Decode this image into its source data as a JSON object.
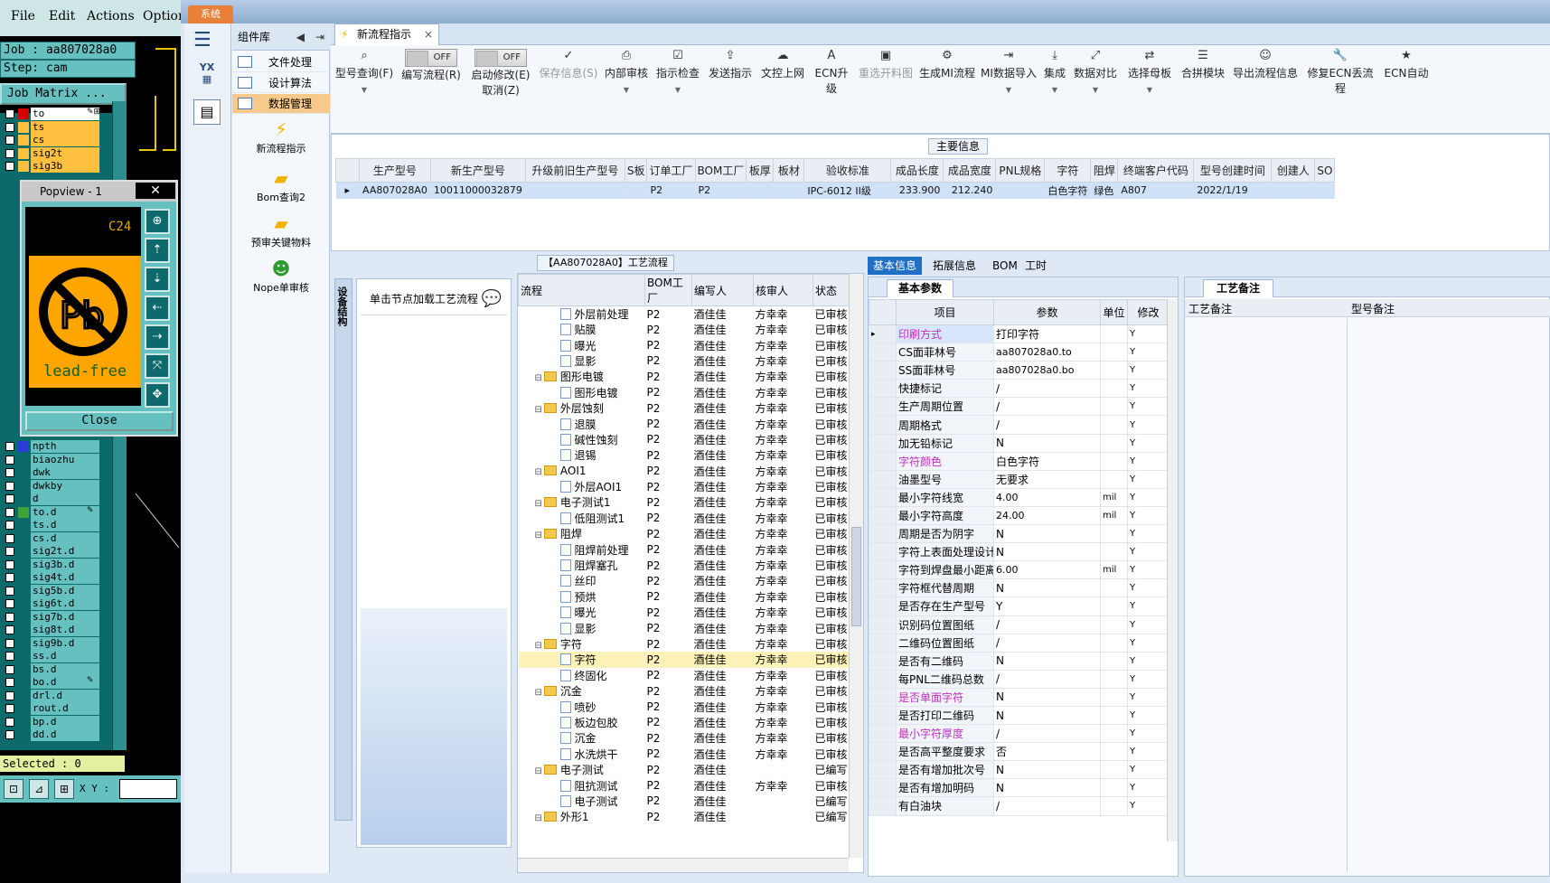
{
  "cam": {
    "menu": [
      "File",
      "Edit",
      "Actions",
      "Options"
    ],
    "job": "Job : aa807028a0",
    "step": "Step: cam",
    "job_matrix": "Job Matrix ...",
    "selected": "Selected : 0",
    "xy_label": "X Y :",
    "layers_top": [
      {
        "name": "to",
        "color": "#ffffff",
        "swatch": "#d40000",
        "mark": "✎⊞"
      },
      {
        "name": "ts",
        "color": "#ffbf3f",
        "swatch": "#ffbf3f",
        "mark": ""
      },
      {
        "name": "cs",
        "color": "#ffbf3f",
        "swatch": "#ffbf3f",
        "mark": ""
      },
      {
        "name": "sig2t",
        "color": "#ffbf3f",
        "swatch": "#ffbf3f",
        "mark": ""
      },
      {
        "name": "sig3b",
        "color": "#ffbf3f",
        "swatch": "#ffbf3f",
        "mark": ""
      }
    ],
    "layers_bottom": [
      {
        "name": "npth",
        "color": "#67c0c0",
        "swatch": "#2a3bd6",
        "mark": ""
      },
      {
        "name": "biaozhu",
        "color": "#67c0c0",
        "swatch": "#0d6a6a",
        "mark": ""
      },
      {
        "name": "dwk",
        "color": "#67c0c0",
        "swatch": "#0d6a6a",
        "mark": ""
      },
      {
        "name": "dwkby",
        "color": "#67c0c0",
        "swatch": "#0d6a6a",
        "mark": ""
      },
      {
        "name": "d",
        "color": "#67c0c0",
        "swatch": "#0d6a6a",
        "mark": ""
      },
      {
        "name": "to.d",
        "color": "#67c0c0",
        "swatch": "#3fa33a",
        "mark": "✎"
      },
      {
        "name": "ts.d",
        "color": "#67c0c0",
        "swatch": "#0d6a6a",
        "mark": ""
      },
      {
        "name": "cs.d",
        "color": "#67c0c0",
        "swatch": "#0d6a6a",
        "mark": ""
      },
      {
        "name": "sig2t.d",
        "color": "#67c0c0",
        "swatch": "#0d6a6a",
        "mark": ""
      },
      {
        "name": "sig3b.d",
        "color": "#67c0c0",
        "swatch": "#0d6a6a",
        "mark": ""
      },
      {
        "name": "sig4t.d",
        "color": "#67c0c0",
        "swatch": "#0d6a6a",
        "mark": ""
      },
      {
        "name": "sig5b.d",
        "color": "#67c0c0",
        "swatch": "#0d6a6a",
        "mark": ""
      },
      {
        "name": "sig6t.d",
        "color": "#67c0c0",
        "swatch": "#0d6a6a",
        "mark": ""
      },
      {
        "name": "sig7b.d",
        "color": "#67c0c0",
        "swatch": "#0d6a6a",
        "mark": ""
      },
      {
        "name": "sig8t.d",
        "color": "#67c0c0",
        "swatch": "#0d6a6a",
        "mark": ""
      },
      {
        "name": "sig9b.d",
        "color": "#67c0c0",
        "swatch": "#0d6a6a",
        "mark": ""
      },
      {
        "name": "ss.d",
        "color": "#67c0c0",
        "swatch": "#0d6a6a",
        "mark": ""
      },
      {
        "name": "bs.d",
        "color": "#67c0c0",
        "swatch": "#0d6a6a",
        "mark": ""
      },
      {
        "name": "bo.d",
        "color": "#67c0c0",
        "swatch": "#0d6a6a",
        "mark": "✎"
      },
      {
        "name": "drl.d",
        "color": "#67c0c0",
        "swatch": "#0d6a6a",
        "mark": ""
      },
      {
        "name": "rout.d",
        "color": "#67c0c0",
        "swatch": "#0d6a6a",
        "mark": ""
      },
      {
        "name": "bp.d",
        "color": "#67c0c0",
        "swatch": "#0d6a6a",
        "mark": ""
      },
      {
        "name": "dd.d",
        "color": "#67c0c0",
        "swatch": "#0d6a6a",
        "mark": ""
      }
    ],
    "popview": {
      "title": "Popview - 1",
      "close": "Close",
      "corner_text": "C24",
      "logo_text": "lead-free"
    }
  },
  "app": {
    "sys_tab": "系统",
    "component_library": "组件库",
    "comp_items": [
      "文件处理",
      "设计算法",
      "数据管理"
    ],
    "comp_big": [
      "新流程指示",
      "Bom查询2",
      "预审关键物料",
      "Nope单审核"
    ],
    "tab_title": "新流程指示",
    "ribbon": [
      {
        "label": "型号查询(F)",
        "icon": "⌕",
        "dd": true,
        "dis": false
      },
      {
        "label": "编写流程(R)",
        "toggle": "OFF",
        "dd": false,
        "dis": false
      },
      {
        "label": "启动修改(E)",
        "label2": "取消(Z)",
        "toggle": "OFF",
        "dd": false,
        "dis": false
      },
      {
        "label": "保存信息(S)",
        "icon": "✓",
        "dd": false,
        "dis": true
      },
      {
        "label": "内部审核",
        "icon": "⎙",
        "dd": true,
        "dis": false
      },
      {
        "label": "指示检查",
        "icon": "☑",
        "dd": true,
        "dis": false
      },
      {
        "label": "发送指示",
        "icon": "⇪",
        "dd": false,
        "dis": false
      },
      {
        "label": "文控上网",
        "icon": "☁",
        "dd": false,
        "dis": false
      },
      {
        "label": "ECN升级",
        "icon": "A",
        "dd": false,
        "dis": false
      },
      {
        "label": "重选开料图",
        "icon": "▣",
        "dd": false,
        "dis": true
      },
      {
        "label": "生成MI流程",
        "icon": "⚙",
        "dd": false,
        "dis": false
      },
      {
        "label": "MI数据导入",
        "icon": "⇥",
        "dd": true,
        "dis": false
      },
      {
        "label": "集成",
        "icon": "⤓",
        "dd": true,
        "dis": false
      },
      {
        "label": "数据对比",
        "icon": "⤢",
        "dd": true,
        "dis": false
      },
      {
        "label": "选择母板",
        "icon": "⇄",
        "dd": true,
        "dis": false
      },
      {
        "label": "合拼模块",
        "icon": "☰",
        "dd": false,
        "dis": false
      },
      {
        "label": "导出流程信息",
        "icon": "☺",
        "dd": false,
        "dis": false
      },
      {
        "label": "修复ECN丢流程",
        "icon": "🔧",
        "dd": false,
        "dis": false
      },
      {
        "label": "ECN自动",
        "icon": "★",
        "dd": false,
        "dis": false
      }
    ],
    "main_info_title": "主要信息",
    "main_info_cols": [
      "生产型号",
      "新生产型号",
      "升级前旧生产型号",
      "S板",
      "订单工厂",
      "BOM工厂",
      "板厚",
      "板材",
      "验收标准",
      "成品长度",
      "成品宽度",
      "PNL规格",
      "字符",
      "阻焊",
      "终端客户代码",
      "型号创建时间",
      "创建人",
      "SO"
    ],
    "main_info_row": [
      "AA807028A0",
      "10011000032879",
      "",
      "",
      "P2",
      "P2",
      "",
      "",
      "IPC-6012 II级",
      "233.900",
      "212.240",
      "",
      "白色字符",
      "绿色",
      "A807",
      "2022/1/19",
      "",
      ""
    ],
    "proc_title": "【AA807028A0】工艺流程",
    "side_tab": "设备结构",
    "load_btn": "单击节点加载工艺流程",
    "tree_cols": [
      "流程",
      "BOM工厂",
      "编写人",
      "核审人",
      "状态"
    ],
    "tree_rows": [
      {
        "lvl": 2,
        "f": false,
        "name": "外层前处理",
        "bom": "P2",
        "w": "酒佳佳",
        "r": "方幸幸",
        "s": "已审核"
      },
      {
        "lvl": 2,
        "f": false,
        "name": "贴膜",
        "bom": "P2",
        "w": "酒佳佳",
        "r": "方幸幸",
        "s": "已审核"
      },
      {
        "lvl": 2,
        "f": false,
        "name": "曝光",
        "bom": "P2",
        "w": "酒佳佳",
        "r": "方幸幸",
        "s": "已审核"
      },
      {
        "lvl": 2,
        "f": false,
        "name": "显影",
        "bom": "P2",
        "w": "酒佳佳",
        "r": "方幸幸",
        "s": "已审核"
      },
      {
        "lvl": 1,
        "f": true,
        "name": "图形电镀",
        "bom": "P2",
        "w": "酒佳佳",
        "r": "方幸幸",
        "s": "已审核"
      },
      {
        "lvl": 2,
        "f": false,
        "name": "图形电镀",
        "bom": "P2",
        "w": "酒佳佳",
        "r": "方幸幸",
        "s": "已审核"
      },
      {
        "lvl": 1,
        "f": true,
        "name": "外层蚀刻",
        "bom": "P2",
        "w": "酒佳佳",
        "r": "方幸幸",
        "s": "已审核"
      },
      {
        "lvl": 2,
        "f": false,
        "name": "退膜",
        "bom": "P2",
        "w": "酒佳佳",
        "r": "方幸幸",
        "s": "已审核"
      },
      {
        "lvl": 2,
        "f": false,
        "name": "碱性蚀刻",
        "bom": "P2",
        "w": "酒佳佳",
        "r": "方幸幸",
        "s": "已审核"
      },
      {
        "lvl": 2,
        "f": false,
        "name": "退锡",
        "bom": "P2",
        "w": "酒佳佳",
        "r": "方幸幸",
        "s": "已审核"
      },
      {
        "lvl": 1,
        "f": true,
        "name": "AOI1",
        "bom": "P2",
        "w": "酒佳佳",
        "r": "方幸幸",
        "s": "已审核"
      },
      {
        "lvl": 2,
        "f": false,
        "name": "外层AOI1",
        "bom": "P2",
        "w": "酒佳佳",
        "r": "方幸幸",
        "s": "已审核"
      },
      {
        "lvl": 1,
        "f": true,
        "name": "电子测试1",
        "bom": "P2",
        "w": "酒佳佳",
        "r": "方幸幸",
        "s": "已审核"
      },
      {
        "lvl": 2,
        "f": false,
        "name": "低阻测试1",
        "bom": "P2",
        "w": "酒佳佳",
        "r": "方幸幸",
        "s": "已审核"
      },
      {
        "lvl": 1,
        "f": true,
        "name": "阻焊",
        "bom": "P2",
        "w": "酒佳佳",
        "r": "方幸幸",
        "s": "已审核"
      },
      {
        "lvl": 2,
        "f": false,
        "name": "阻焊前处理",
        "bom": "P2",
        "w": "酒佳佳",
        "r": "方幸幸",
        "s": "已审核"
      },
      {
        "lvl": 2,
        "f": false,
        "name": "阻焊塞孔",
        "bom": "P2",
        "w": "酒佳佳",
        "r": "方幸幸",
        "s": "已审核"
      },
      {
        "lvl": 2,
        "f": false,
        "name": "丝印",
        "bom": "P2",
        "w": "酒佳佳",
        "r": "方幸幸",
        "s": "已审核"
      },
      {
        "lvl": 2,
        "f": false,
        "name": "预烘",
        "bom": "P2",
        "w": "酒佳佳",
        "r": "方幸幸",
        "s": "已审核"
      },
      {
        "lvl": 2,
        "f": false,
        "name": "曝光",
        "bom": "P2",
        "w": "酒佳佳",
        "r": "方幸幸",
        "s": "已审核"
      },
      {
        "lvl": 2,
        "f": false,
        "name": "显影",
        "bom": "P2",
        "w": "酒佳佳",
        "r": "方幸幸",
        "s": "已审核"
      },
      {
        "lvl": 1,
        "f": true,
        "name": "字符",
        "bom": "P2",
        "w": "酒佳佳",
        "r": "方幸幸",
        "s": "已审核"
      },
      {
        "lvl": 2,
        "f": false,
        "name": "字符",
        "bom": "P2",
        "w": "酒佳佳",
        "r": "方幸幸",
        "s": "已审核",
        "hl": true
      },
      {
        "lvl": 2,
        "f": false,
        "name": "终固化",
        "bom": "P2",
        "w": "酒佳佳",
        "r": "方幸幸",
        "s": "已审核"
      },
      {
        "lvl": 1,
        "f": true,
        "name": "沉金",
        "bom": "P2",
        "w": "酒佳佳",
        "r": "方幸幸",
        "s": "已审核"
      },
      {
        "lvl": 2,
        "f": false,
        "name": "喷砂",
        "bom": "P2",
        "w": "酒佳佳",
        "r": "方幸幸",
        "s": "已审核"
      },
      {
        "lvl": 2,
        "f": false,
        "name": "板边包胶",
        "bom": "P2",
        "w": "酒佳佳",
        "r": "方幸幸",
        "s": "已审核"
      },
      {
        "lvl": 2,
        "f": false,
        "name": "沉金",
        "bom": "P2",
        "w": "酒佳佳",
        "r": "方幸幸",
        "s": "已审核"
      },
      {
        "lvl": 2,
        "f": false,
        "name": "水洗烘干",
        "bom": "P2",
        "w": "酒佳佳",
        "r": "方幸幸",
        "s": "已审核"
      },
      {
        "lvl": 1,
        "f": true,
        "name": "电子测试",
        "bom": "P2",
        "w": "酒佳佳",
        "r": "",
        "s": "已编写"
      },
      {
        "lvl": 2,
        "f": false,
        "name": "阻抗测试",
        "bom": "P2",
        "w": "酒佳佳",
        "r": "方幸幸",
        "s": "已审核"
      },
      {
        "lvl": 2,
        "f": false,
        "name": "电子测试",
        "bom": "P2",
        "w": "酒佳佳",
        "r": "",
        "s": "已编写"
      },
      {
        "lvl": 1,
        "f": true,
        "name": "外形1",
        "bom": "P2",
        "w": "酒佳佳",
        "r": "",
        "s": "已编写"
      }
    ],
    "right_tabs": [
      "基本信息",
      "拓展信息",
      "BOM",
      "工时"
    ],
    "basic_params_title": "基本参数",
    "param_cols": [
      "项目",
      "参数",
      "单位",
      "修改"
    ],
    "params": [
      {
        "item": "印刷方式",
        "val": "打印字符",
        "unit": "",
        "mod": "Y",
        "cls": "selitem"
      },
      {
        "item": "CS面菲林号",
        "val": "aa807028a0.to",
        "unit": "",
        "mod": "Y",
        "cls": ""
      },
      {
        "item": "SS面菲林号",
        "val": "aa807028a0.bo",
        "unit": "",
        "mod": "Y",
        "cls": ""
      },
      {
        "item": "快捷标记",
        "val": "/",
        "unit": "",
        "mod": "Y",
        "cls": ""
      },
      {
        "item": "生产周期位置",
        "val": "/",
        "unit": "",
        "mod": "Y",
        "cls": ""
      },
      {
        "item": "周期格式",
        "val": "/",
        "unit": "",
        "mod": "Y",
        "cls": ""
      },
      {
        "item": "加无铅标记",
        "val": "N",
        "unit": "",
        "mod": "Y",
        "cls": ""
      },
      {
        "item": "字符颜色",
        "val": "白色字符",
        "unit": "",
        "mod": "Y",
        "cls": "hot"
      },
      {
        "item": "油墨型号",
        "val": "无要求",
        "unit": "",
        "mod": "Y",
        "cls": ""
      },
      {
        "item": "最小字符线宽",
        "val": "4.00",
        "unit": "mil",
        "mod": "Y",
        "cls": ""
      },
      {
        "item": "最小字符高度",
        "val": "24.00",
        "unit": "mil",
        "mod": "Y",
        "cls": ""
      },
      {
        "item": "周期是否为阴字",
        "val": "N",
        "unit": "",
        "mod": "Y",
        "cls": ""
      },
      {
        "item": "字符上表面处理设计",
        "val": "N",
        "unit": "",
        "mod": "Y",
        "cls": ""
      },
      {
        "item": "字符到焊盘最小距离",
        "val": "6.00",
        "unit": "mil",
        "mod": "Y",
        "cls": ""
      },
      {
        "item": "字符框代替周期",
        "val": "N",
        "unit": "",
        "mod": "Y",
        "cls": ""
      },
      {
        "item": "是否存在生产型号",
        "val": "Y",
        "unit": "",
        "mod": "Y",
        "cls": ""
      },
      {
        "item": "识别码位置图纸",
        "val": "/",
        "unit": "",
        "mod": "Y",
        "cls": ""
      },
      {
        "item": "二维码位置图纸",
        "val": "/",
        "unit": "",
        "mod": "Y",
        "cls": ""
      },
      {
        "item": "是否有二维码",
        "val": "N",
        "unit": "",
        "mod": "Y",
        "cls": ""
      },
      {
        "item": "每PNL二维码总数",
        "val": "/",
        "unit": "",
        "mod": "Y",
        "cls": ""
      },
      {
        "item": "是否单面字符",
        "val": "N",
        "unit": "",
        "mod": "Y",
        "cls": "hot"
      },
      {
        "item": "是否打印二维码",
        "val": "N",
        "unit": "",
        "mod": "Y",
        "cls": ""
      },
      {
        "item": "最小字符厚度",
        "val": "/",
        "unit": "",
        "mod": "Y",
        "cls": "hot"
      },
      {
        "item": "是否高平整度要求",
        "val": "否",
        "unit": "",
        "mod": "Y",
        "cls": ""
      },
      {
        "item": "是否有增加批次号",
        "val": "N",
        "unit": "",
        "mod": "Y",
        "cls": ""
      },
      {
        "item": "是否有增加明码",
        "val": "N",
        "unit": "",
        "mod": "Y",
        "cls": ""
      },
      {
        "item": "有白油块",
        "val": "/",
        "unit": "",
        "mod": "Y",
        "cls": ""
      }
    ],
    "remark_title": "工艺备注",
    "remark_cols": [
      "工艺备注",
      "型号备注"
    ]
  }
}
